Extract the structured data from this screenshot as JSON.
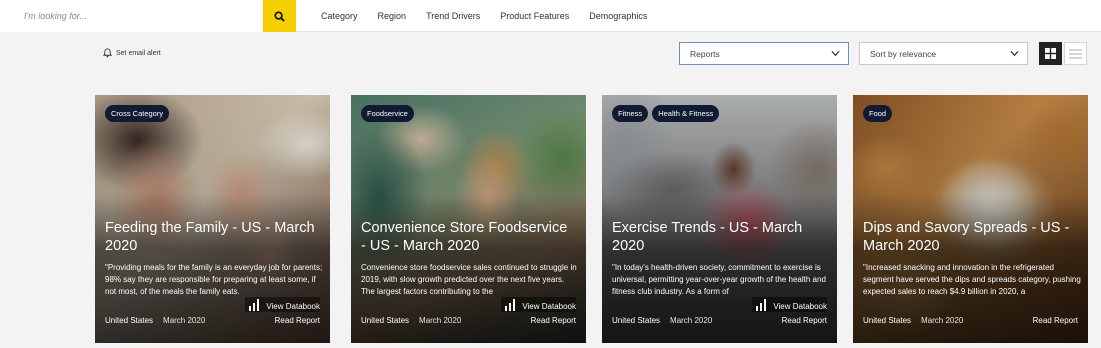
{
  "search": {
    "placeholder": "I'm looking for..."
  },
  "nav": [
    "Category",
    "Region",
    "Trend Drivers",
    "Product Features",
    "Demographics"
  ],
  "toolbar": {
    "email_alert": "Set email alert",
    "type_select": "Reports",
    "sort_select": "Sort by relevance"
  },
  "colors": {
    "accent": "#f5d000",
    "tag_bg": "#111a33"
  },
  "cards": [
    {
      "tags": [
        "Cross Category"
      ],
      "title": "Feeding the Family - US - March 2020",
      "desc": "\"Providing meals for the family is an everyday job for parents; 98% say they are responsible for preparing at least some, if not most, of the meals the family eats.",
      "databook": "View Databook",
      "region": "United States",
      "date": "March 2020",
      "read": "Read Report"
    },
    {
      "tags": [
        "Foodservice"
      ],
      "title": "Convenience Store Foodservice - US - March 2020",
      "desc": "Convenience store foodservice sales continued to struggle in 2019, with slow growth predicted over the next five years. The largest factors contributing to the",
      "databook": "View Databook",
      "region": "United States",
      "date": "March 2020",
      "read": "Read Report"
    },
    {
      "tags": [
        "Fitness",
        "Health & Fitness"
      ],
      "title": "Exercise Trends - US - March 2020",
      "desc": "\"In today's health-driven society, commitment to exercise is universal, permitting year-over-year growth of the health and fitness club industry. As a form of",
      "databook": "View Databook",
      "region": "United States",
      "date": "March 2020",
      "read": "Read Report"
    },
    {
      "tags": [
        "Food"
      ],
      "title": "Dips and Savory Spreads - US - March 2020",
      "desc": "\"Increased snacking and innovation in the refrigerated segment have served the dips and spreads category, pushing expected sales to reach $4.9 billion in 2020, a",
      "databook": "",
      "region": "United States",
      "date": "March 2020",
      "read": "Read Report"
    }
  ]
}
